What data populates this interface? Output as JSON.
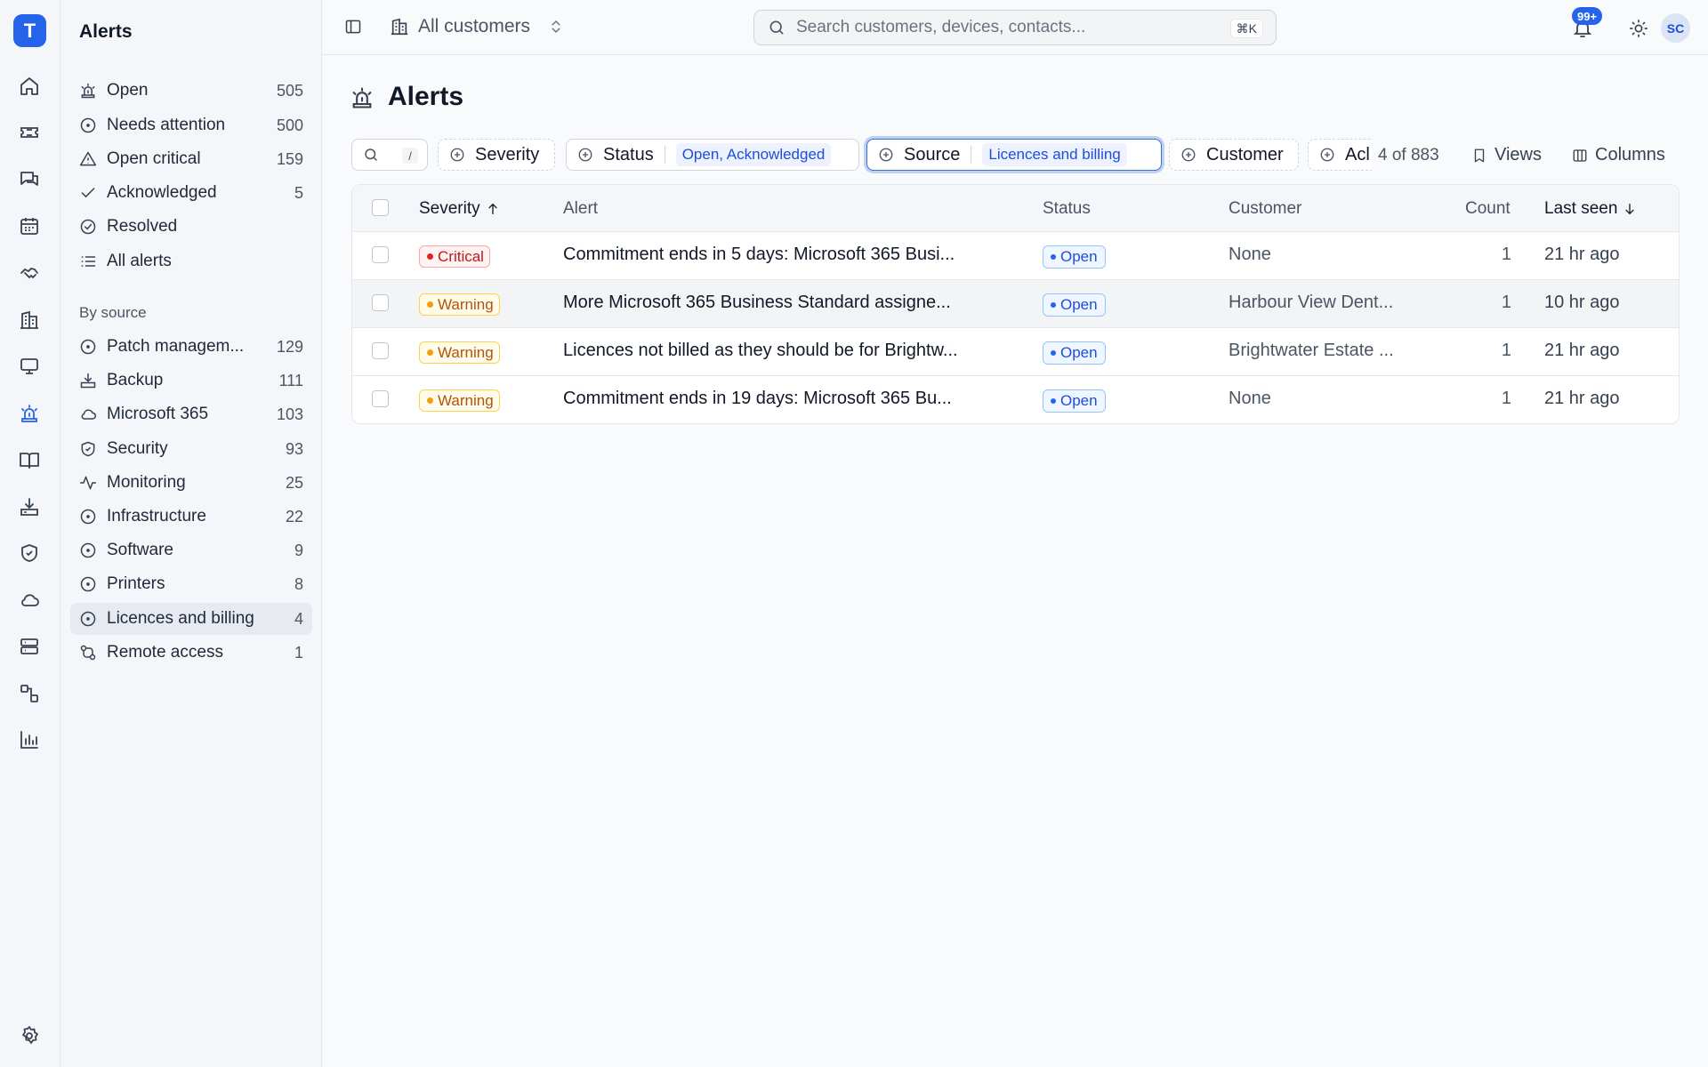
{
  "app": {
    "logo_letter": "T"
  },
  "rail": {
    "items": [
      "home-icon",
      "ticket-icon",
      "chat-icon",
      "calendar-icon",
      "handshake-icon",
      "building-icon",
      "monitor-icon",
      "alarm-icon",
      "book-icon",
      "download-icon",
      "shield-icon",
      "cloud-icon",
      "server-icon",
      "workflow-icon",
      "chart-icon"
    ],
    "active": "alarm-icon",
    "footer": "settings-icon"
  },
  "sidebar": {
    "title": "Alerts",
    "items": [
      {
        "label": "Open",
        "count": "505",
        "icon": "alarm-icon"
      },
      {
        "label": "Needs attention",
        "count": "500",
        "icon": "circle-dot-icon"
      },
      {
        "label": "Open critical",
        "count": "159",
        "icon": "warning-triangle-icon"
      },
      {
        "label": "Acknowledged",
        "count": "5",
        "icon": "check-icon"
      },
      {
        "label": "Resolved",
        "count": "",
        "icon": "circle-check-icon"
      },
      {
        "label": "All alerts",
        "count": "",
        "icon": "list-icon"
      }
    ],
    "section_label": "By source",
    "sources": [
      {
        "label": "Patch managem...",
        "count": "129",
        "icon": "circle-dot-icon"
      },
      {
        "label": "Backup",
        "count": "111",
        "icon": "download-tray-icon"
      },
      {
        "label": "Microsoft 365",
        "count": "103",
        "icon": "cloud-icon"
      },
      {
        "label": "Security",
        "count": "93",
        "icon": "shield-check-icon"
      },
      {
        "label": "Monitoring",
        "count": "25",
        "icon": "activity-icon"
      },
      {
        "label": "Infrastructure",
        "count": "22",
        "icon": "circle-dot-icon"
      },
      {
        "label": "Software",
        "count": "9",
        "icon": "circle-dot-icon"
      },
      {
        "label": "Printers",
        "count": "8",
        "icon": "circle-dot-icon"
      },
      {
        "label": "Licences and billing",
        "count": "4",
        "icon": "circle-dot-icon",
        "active": true
      },
      {
        "label": "Remote access",
        "count": "1",
        "icon": "remote-icon"
      }
    ]
  },
  "topbar": {
    "customer_selector": "All customers",
    "search_placeholder": "Search customers, devices, contacts...",
    "search_shortcut": "⌘K",
    "notifications_badge": "99+",
    "avatar_initials": "SC"
  },
  "page": {
    "title": "Alerts"
  },
  "filters": {
    "search_shortcut": "/",
    "severity_label": "Severity",
    "status_label": "Status",
    "status_value": "Open, Acknowledged",
    "source_label": "Source",
    "source_value": "Licences and billing",
    "customer_label": "Customer",
    "ack_label": "Acl",
    "result_count": "4 of 883",
    "views_label": "Views",
    "columns_label": "Columns"
  },
  "table": {
    "headers": {
      "severity": "Severity",
      "alert": "Alert",
      "status": "Status",
      "customer": "Customer",
      "count": "Count",
      "last_seen": "Last seen"
    },
    "rows": [
      {
        "severity": "Critical",
        "alert": "Commitment ends in 5 days: Microsoft 365 Busi...",
        "status": "Open",
        "customer": "None",
        "count": "1",
        "last_seen": "21 hr ago"
      },
      {
        "severity": "Warning",
        "alert": "More Microsoft 365 Business Standard assigne...",
        "status": "Open",
        "customer": "Harbour View Dent...",
        "count": "1",
        "last_seen": "10 hr ago"
      },
      {
        "severity": "Warning",
        "alert": "Licences not billed as they should be for Brightw...",
        "status": "Open",
        "customer": "Brightwater Estate ...",
        "count": "1",
        "last_seen": "21 hr ago"
      },
      {
        "severity": "Warning",
        "alert": "Commitment ends in 19 days: Microsoft 365 Bu...",
        "status": "Open",
        "customer": "None",
        "count": "1",
        "last_seen": "21 hr ago"
      }
    ]
  },
  "colors": {
    "accent": "#2563eb",
    "critical": "#dc2626",
    "warning": "#f59e0b"
  }
}
